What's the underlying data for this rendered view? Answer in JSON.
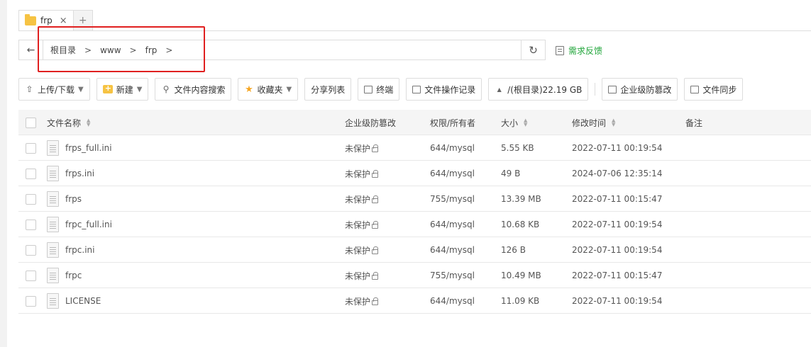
{
  "tabs": [
    {
      "label": "frp",
      "close": "×"
    },
    {
      "label": "+"
    }
  ],
  "address": {
    "back": "←",
    "crumbs": [
      "根目录",
      "www",
      "frp"
    ],
    "separator": ">",
    "refresh": "↻"
  },
  "feedback": {
    "label": "需求反馈"
  },
  "toolbar": {
    "upload": "上传/下载",
    "new": "新建",
    "search": "文件内容搜索",
    "favorites": "收藏夹",
    "share": "分享列表",
    "terminal": "终端",
    "oplog": "文件操作记录",
    "disk": "/(根目录)22.19 GB",
    "tamper": "企业级防篡改",
    "sync": "文件同步"
  },
  "table": {
    "headers": {
      "name": "文件名称",
      "protect": "企业级防篡改",
      "perm": "权限/所有者",
      "size": "大小",
      "time": "修改时间",
      "note": "备注"
    },
    "rows": [
      {
        "name": "frps_full.ini",
        "protect": "未保护",
        "perm": "644/mysql",
        "size": "5.55 KB",
        "time": "2022-07-11 00:19:54"
      },
      {
        "name": "frps.ini",
        "protect": "未保护",
        "perm": "644/mysql",
        "size": "49 B",
        "time": "2024-07-06 12:35:14"
      },
      {
        "name": "frps",
        "protect": "未保护",
        "perm": "755/mysql",
        "size": "13.39 MB",
        "time": "2022-07-11 00:15:47"
      },
      {
        "name": "frpc_full.ini",
        "protect": "未保护",
        "perm": "644/mysql",
        "size": "10.68 KB",
        "time": "2022-07-11 00:19:54"
      },
      {
        "name": "frpc.ini",
        "protect": "未保护",
        "perm": "644/mysql",
        "size": "126 B",
        "time": "2022-07-11 00:19:54"
      },
      {
        "name": "frpc",
        "protect": "未保护",
        "perm": "755/mysql",
        "size": "10.49 MB",
        "time": "2022-07-11 00:15:47"
      },
      {
        "name": "LICENSE",
        "protect": "未保护",
        "perm": "644/mysql",
        "size": "11.09 KB",
        "time": "2022-07-11 00:19:54"
      }
    ]
  },
  "colors": {
    "accent": "#20a53a",
    "highlight": "#e02020",
    "folder": "#f6c343"
  }
}
